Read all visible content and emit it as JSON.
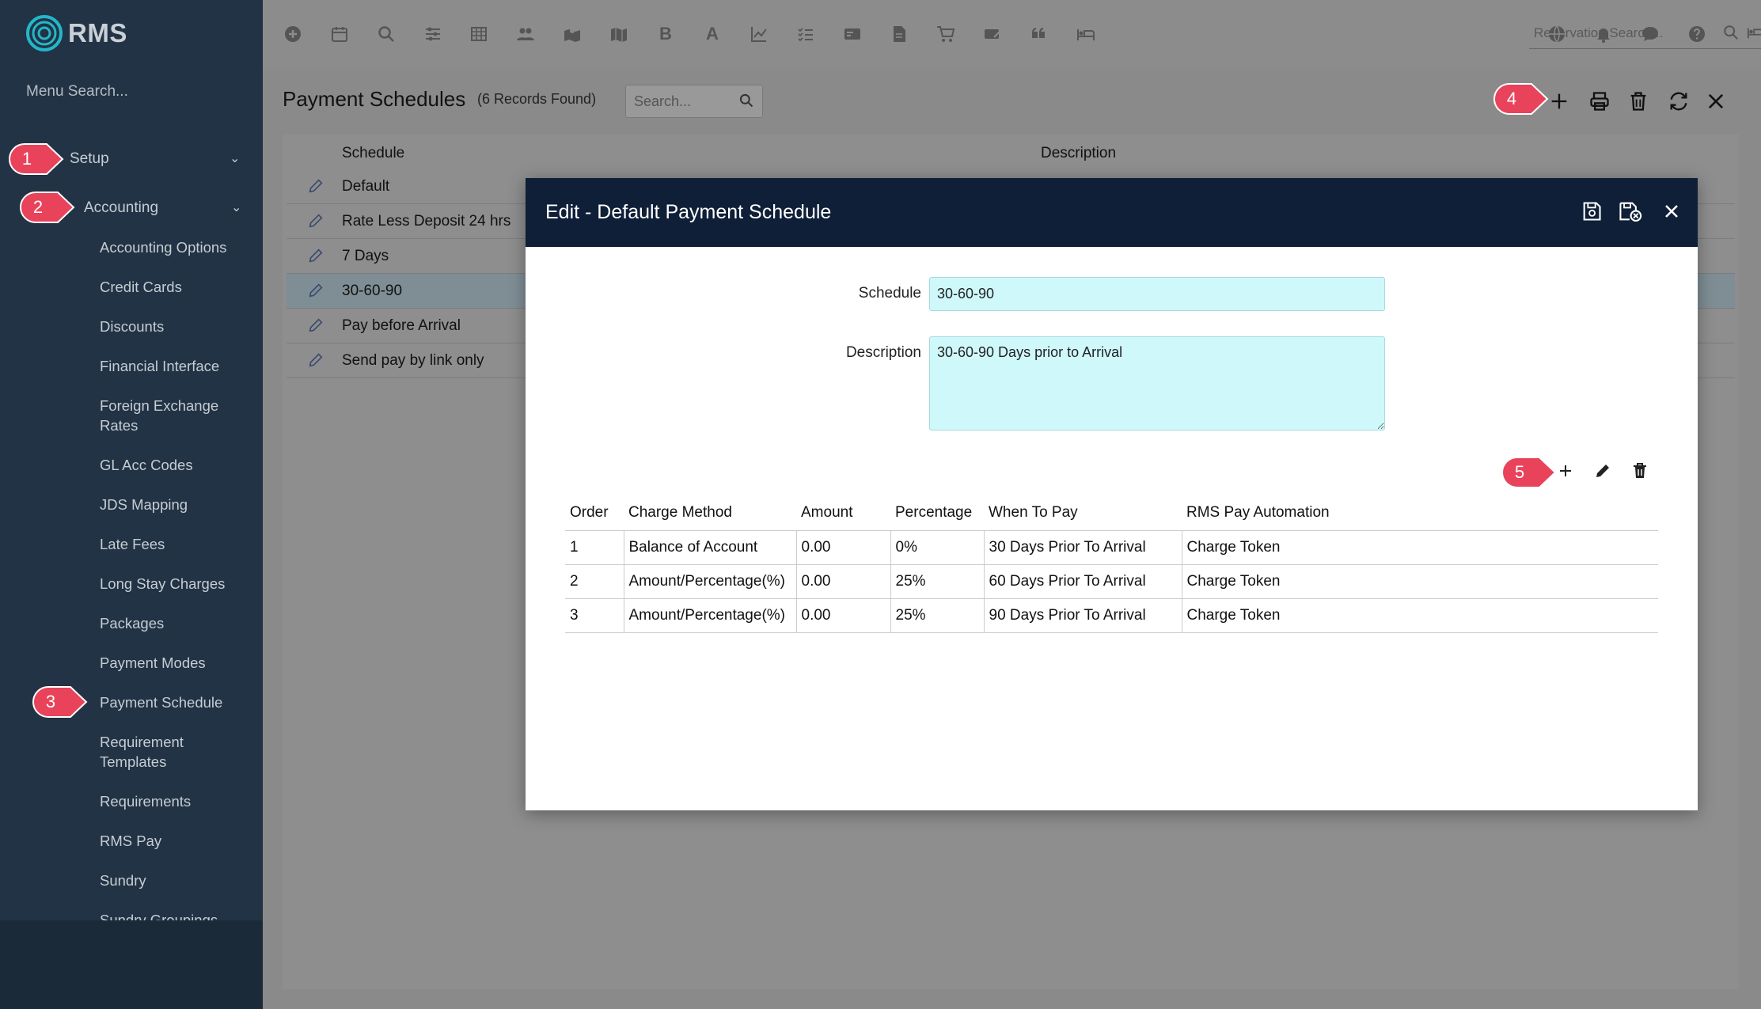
{
  "app": {
    "logo_text": "RMS"
  },
  "sidebar": {
    "menu_search_placeholder": "Menu Search...",
    "setup_label": "Setup",
    "accounting_label": "Accounting",
    "items": [
      "Accounting Options",
      "Credit Cards",
      "Discounts",
      "Financial Interface",
      "Foreign Exchange Rates",
      "GL Acc Codes",
      "JDS Mapping",
      "Late Fees",
      "Long Stay Charges",
      "Packages",
      "Payment Modes",
      "Payment Schedule",
      "Requirement Templates",
      "Requirements",
      "RMS Pay",
      "Sundry",
      "Sundry Groupings"
    ]
  },
  "toolbar": {
    "reservation_search_placeholder": "Reservation Search...",
    "bold_glyph": "B",
    "font_glyph": "A"
  },
  "page": {
    "title": "Payment Schedules",
    "records": "(6 Records Found)",
    "search_placeholder": "Search...",
    "col_schedule": "Schedule",
    "col_description": "Description",
    "rows": [
      "Default",
      "Rate Less Deposit 24 hrs",
      "7 Days",
      "30-60-90",
      "Pay before Arrival",
      "Send pay by link only"
    ],
    "selected_row": "30-60-90"
  },
  "modal": {
    "title": "Edit - Default Payment Schedule",
    "schedule_label": "Schedule",
    "schedule_value": "30-60-90",
    "description_label": "Description",
    "description_value": "30-60-90 Days prior to Arrival",
    "columns": [
      "Order",
      "Charge Method",
      "Amount",
      "Percentage",
      "When To Pay",
      "RMS Pay Automation"
    ],
    "rows": [
      [
        "1",
        "Balance of Account",
        "0.00",
        "0%",
        "30 Days Prior To Arrival",
        "Charge Token"
      ],
      [
        "2",
        "Amount/Percentage(%)",
        "0.00",
        "25%",
        "60 Days Prior To Arrival",
        "Charge Token"
      ],
      [
        "3",
        "Amount/Percentage(%)",
        "0.00",
        "25%",
        "90 Days Prior To Arrival",
        "Charge Token"
      ]
    ]
  },
  "markers": [
    "1",
    "2",
    "3",
    "4",
    "5"
  ],
  "colors": {
    "sidebar": "#223345",
    "modal_header": "#0f1f38",
    "input_bg": "#cff8fb",
    "marker": "#e8435a"
  }
}
